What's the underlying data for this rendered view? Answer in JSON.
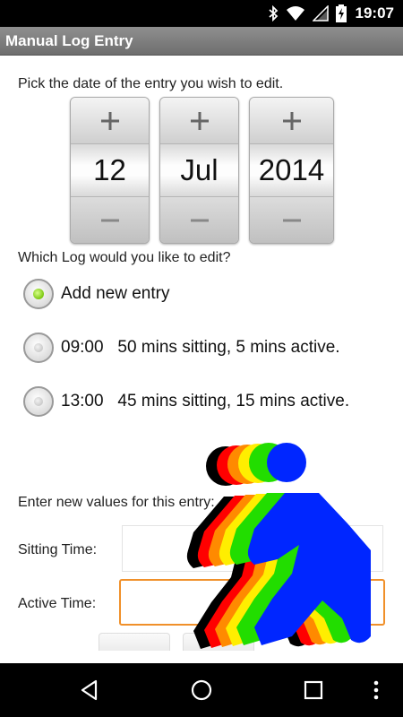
{
  "status_bar": {
    "time": "19:07",
    "icons": [
      "bluetooth-icon",
      "wifi-icon",
      "signal-icon",
      "battery-charging-icon"
    ]
  },
  "app": {
    "title": "Manual Log Entry"
  },
  "date_section": {
    "prompt": "Pick the date of the entry you wish to edit.",
    "increment_symbol": "+",
    "decrement_symbol": "−",
    "day": "12",
    "month": "Jul",
    "year": "2014"
  },
  "log_section": {
    "prompt": "Which Log would you like to edit?",
    "options": [
      {
        "label": "Add new entry",
        "checked": true
      },
      {
        "label": "09:00   50 mins sitting, 5 mins active.",
        "checked": false
      },
      {
        "label": "13:00   45 mins sitting, 15 mins active.",
        "checked": false
      }
    ]
  },
  "entry_section": {
    "prompt": "Enter new values for this entry:",
    "sitting_label": "Sitting Time:",
    "sitting_value": "",
    "active_label": "Active Time:",
    "active_value": ""
  },
  "colors": {
    "accent_focus": "#f0902a",
    "radio_checked": "#7ac70e",
    "figure_layers": [
      "#000000",
      "#ff0000",
      "#ff8a00",
      "#ffee00",
      "#22dd00",
      "#0026ff"
    ]
  },
  "nav_bar": {
    "icons": [
      "back-icon",
      "home-icon",
      "recents-icon",
      "overflow-menu-icon"
    ]
  }
}
